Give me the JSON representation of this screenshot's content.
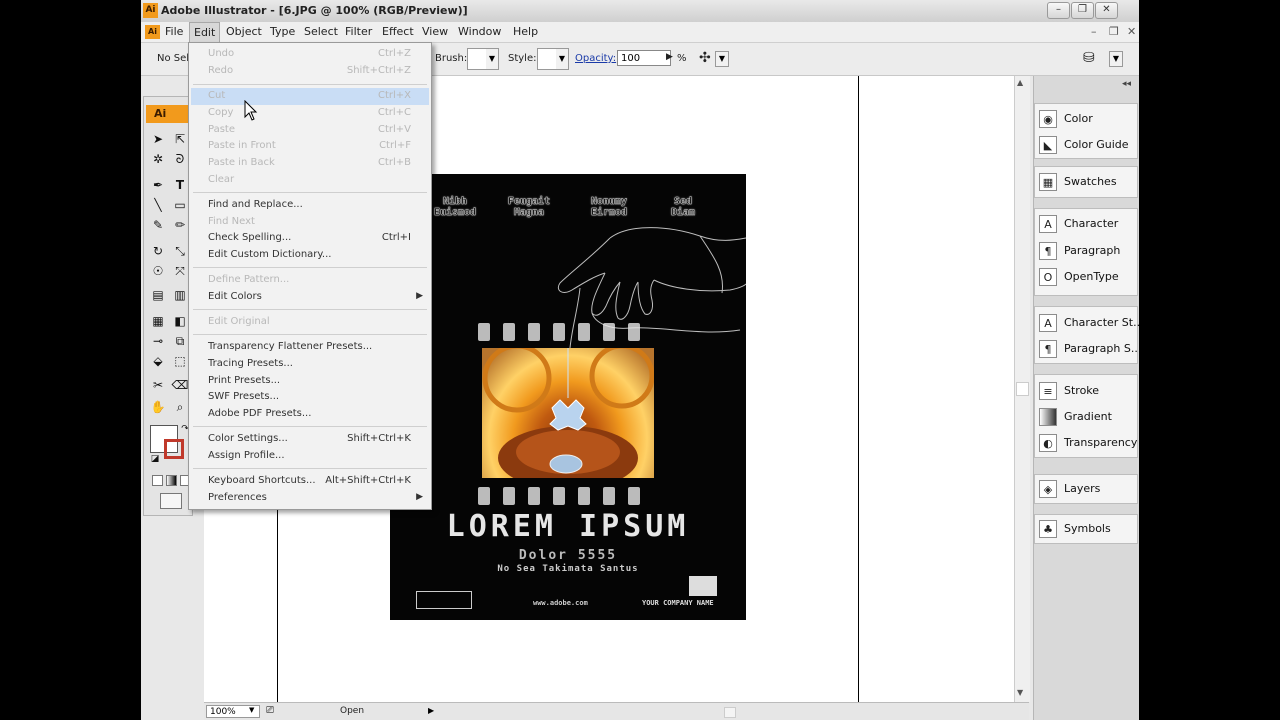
{
  "window": {
    "title": "Adobe Illustrator - [6.JPG @ 100% (RGB/Preview)]",
    "logo": "Ai"
  },
  "menubar": {
    "items": [
      "File",
      "Edit",
      "Object",
      "Type",
      "Select",
      "Filter",
      "Effect",
      "View",
      "Window",
      "Help"
    ],
    "active": "Edit"
  },
  "controlbar": {
    "selection_text": "No Sel",
    "brush_label": "Brush:",
    "style_label": "Style:",
    "opacity_label": "Opacity:",
    "opacity_value": "100",
    "percent": "%"
  },
  "edit_menu": {
    "undo": {
      "label": "Undo",
      "shortcut": "Ctrl+Z"
    },
    "redo": {
      "label": "Redo",
      "shortcut": "Shift+Ctrl+Z"
    },
    "cut": {
      "label": "Cut",
      "shortcut": "Ctrl+X"
    },
    "copy": {
      "label": "Copy",
      "shortcut": "Ctrl+C"
    },
    "paste": {
      "label": "Paste",
      "shortcut": "Ctrl+V"
    },
    "paste_front": {
      "label": "Paste in Front",
      "shortcut": "Ctrl+F"
    },
    "paste_back": {
      "label": "Paste in Back",
      "shortcut": "Ctrl+B"
    },
    "clear": {
      "label": "Clear"
    },
    "find_replace": {
      "label": "Find and Replace..."
    },
    "find_next": {
      "label": "Find Next"
    },
    "check_spelling": {
      "label": "Check Spelling...",
      "shortcut": "Ctrl+I"
    },
    "custom_dictionary": {
      "label": "Edit Custom Dictionary..."
    },
    "define_pattern": {
      "label": "Define Pattern..."
    },
    "edit_colors": {
      "label": "Edit Colors"
    },
    "edit_original": {
      "label": "Edit Original"
    },
    "transparency_presets": {
      "label": "Transparency Flattener Presets..."
    },
    "tracing_presets": {
      "label": "Tracing Presets..."
    },
    "print_presets": {
      "label": "Print Presets..."
    },
    "swf_presets": {
      "label": "SWF Presets..."
    },
    "pdf_presets": {
      "label": "Adobe PDF Presets..."
    },
    "color_settings": {
      "label": "Color Settings...",
      "shortcut": "Shift+Ctrl+K"
    },
    "assign_profile": {
      "label": "Assign Profile..."
    },
    "keyboard_shortcuts": {
      "label": "Keyboard Shortcuts...",
      "shortcut": "Alt+Shift+Ctrl+K"
    },
    "preferences": {
      "label": "Preferences"
    }
  },
  "poster": {
    "columns": [
      {
        "line1": "Nibh",
        "line2": "Euismod"
      },
      {
        "line1": "Feugait",
        "line2": "Magna"
      },
      {
        "line1": "Nonumy",
        "line2": "Eirmod"
      },
      {
        "line1": "Sed",
        "line2": "Diam"
      }
    ],
    "title": "LOREM IPSUM",
    "subtitle": "Dolor 5555",
    "tagline": "No Sea Takimata Santus",
    "url": "www.adobe.com",
    "company": "YOUR COMPANY NAME"
  },
  "right_panel": {
    "group1": [
      "Color",
      "Color Guide"
    ],
    "group2": [
      "Swatches"
    ],
    "group3": [
      "Character",
      "Paragraph",
      "OpenType"
    ],
    "group4": [
      "Character St...",
      "Paragraph S..."
    ],
    "group5": [
      "Stroke",
      "Gradient",
      "Transparency"
    ],
    "group6": [
      "Layers"
    ],
    "group7": [
      "Symbols"
    ]
  },
  "statusbar": {
    "zoom": "100%",
    "status": "Open"
  },
  "icons": {
    "color": "palette-icon",
    "color_guide": "color-guide-icon",
    "swatches": "swatches-grid-icon",
    "character": "character-A-icon",
    "paragraph": "pilcrow-icon",
    "opentype": "opentype-icon",
    "stroke": "stroke-lines-icon",
    "gradient": "gradient-icon",
    "transparency": "transparency-icon",
    "layers": "layers-icon",
    "symbols": "club-symbol-icon"
  },
  "colors": {
    "accent_orange": "#f29a1c",
    "menu_highlight": "#c9ddf5"
  }
}
